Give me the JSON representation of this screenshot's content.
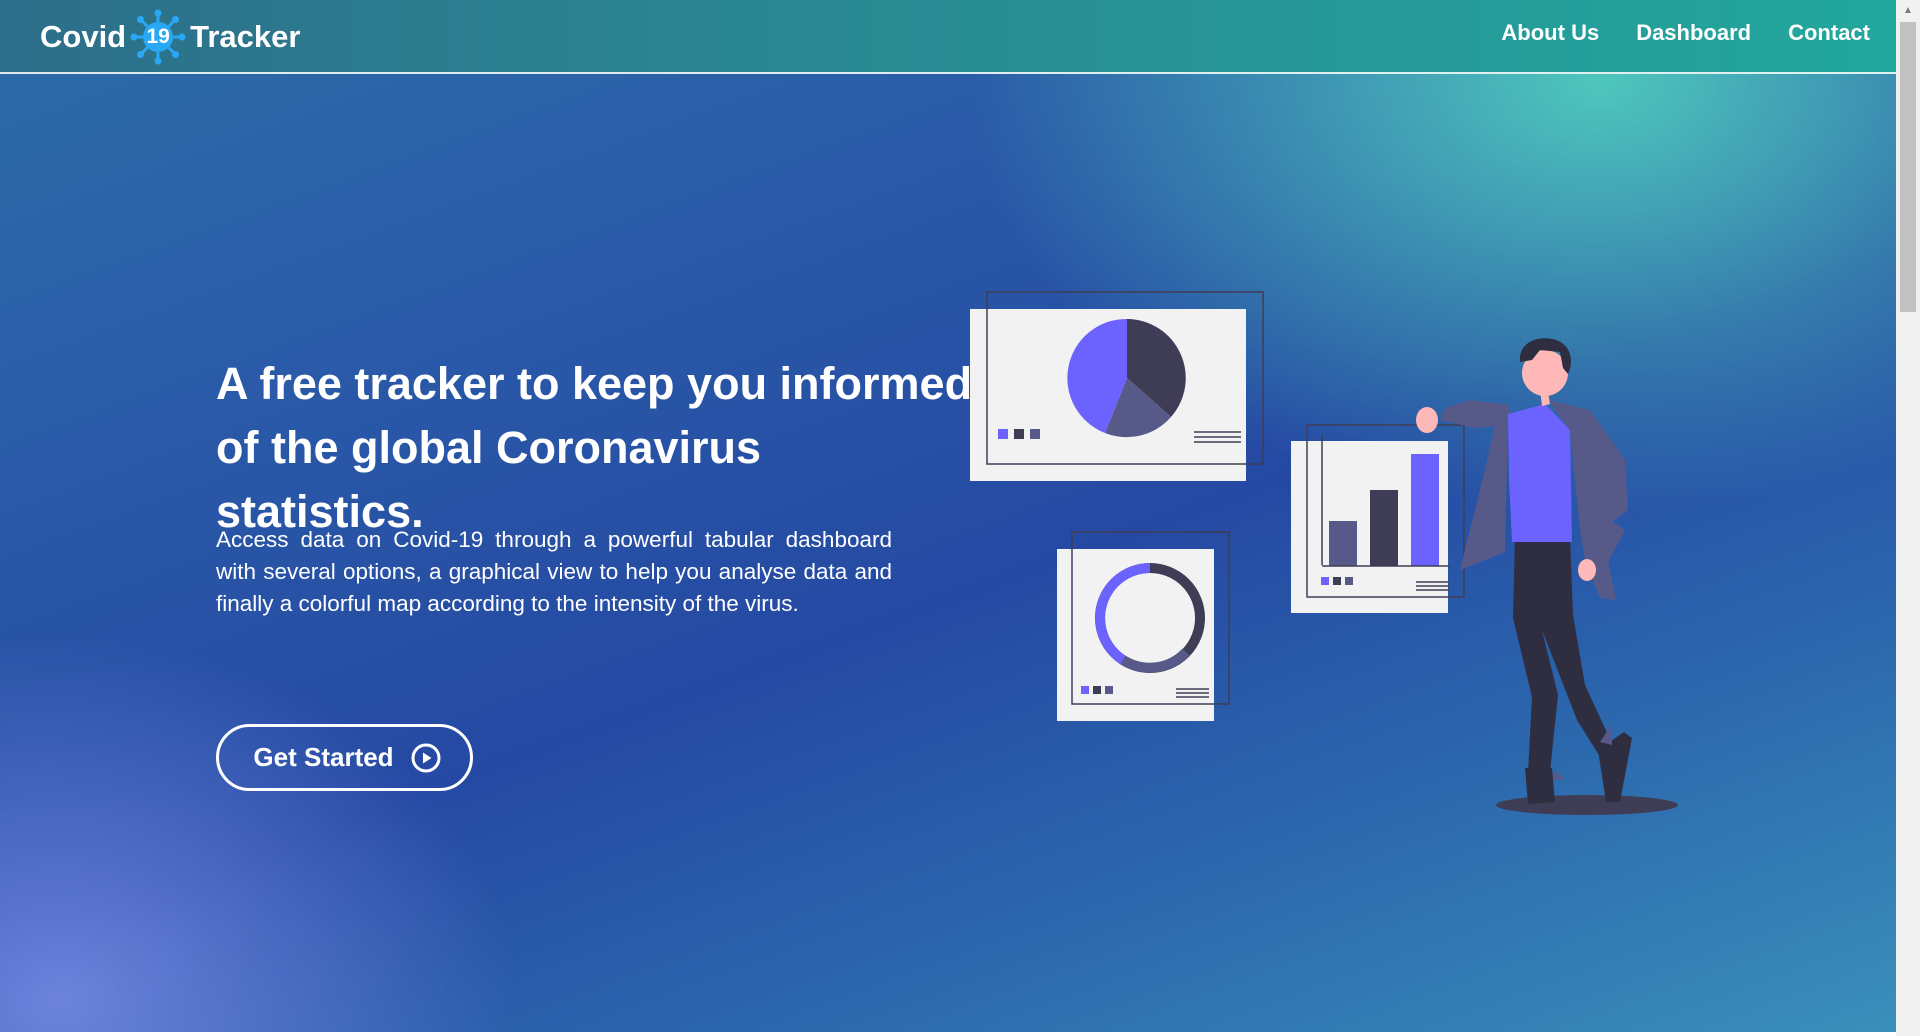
{
  "brand": {
    "name_left": "Covid",
    "virus_number": "19",
    "name_right": "Tracker"
  },
  "nav": {
    "items": [
      "About Us",
      "Dashboard",
      "Contact"
    ]
  },
  "hero": {
    "headline_line1": "A free tracker to keep you informed",
    "headline_line2": "of the global Coronavirus statistics.",
    "description": "Access data on Covid-19 through a powerful tabular dashboard with several options, a graphical view to help you analyse data and finally a colorful map according to the intensity of the virus.",
    "cta_label": "Get Started"
  },
  "colors": {
    "accent_purple": "#6c63ff",
    "dark_slate": "#3f3d56",
    "muted_purple": "#575a89",
    "card_bg": "#f2f2f2",
    "virus_blue": "#29a8f5"
  },
  "icons": {
    "logo": "virus-icon",
    "cta": "play-circle-icon"
  }
}
